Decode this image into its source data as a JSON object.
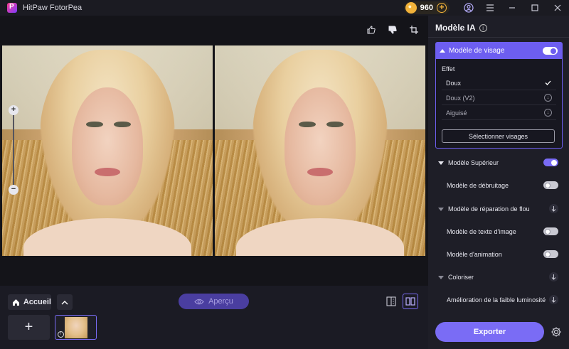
{
  "app": {
    "title": "HitPaw FotorPea",
    "coins": "960"
  },
  "panel": {
    "title": "Modèle IA",
    "face_model": {
      "label": "Modèle de visage",
      "enabled": true,
      "effect_label": "Effet",
      "options": [
        {
          "label": "Doux",
          "state": "selected"
        },
        {
          "label": "Doux (V2)",
          "state": "download"
        },
        {
          "label": "Aiguisé",
          "state": "download"
        }
      ],
      "select_faces_label": "Sélectionner visages"
    },
    "models": [
      {
        "label": "Modèle Supérieur",
        "control": "toggle",
        "enabled": true
      },
      {
        "label": "Modèle de débruitage",
        "control": "toggle",
        "enabled": false
      },
      {
        "label": "Modèle de réparation de flou",
        "control": "download"
      },
      {
        "label": "Modèle de texte d'image",
        "control": "toggle",
        "enabled": false
      },
      {
        "label": "Modèle d'animation",
        "control": "toggle",
        "enabled": false
      },
      {
        "label": "Coloriser",
        "control": "download"
      },
      {
        "label": "Amélioration de la faible luminosité",
        "control": "download"
      }
    ],
    "export_label": "Exporter"
  },
  "bottom": {
    "home_label": "Accueil",
    "preview_label": "Aperçu"
  },
  "colors": {
    "accent": "#7a6cf5",
    "panel_bg": "#1e1e27",
    "canvas_bg": "#141419"
  }
}
